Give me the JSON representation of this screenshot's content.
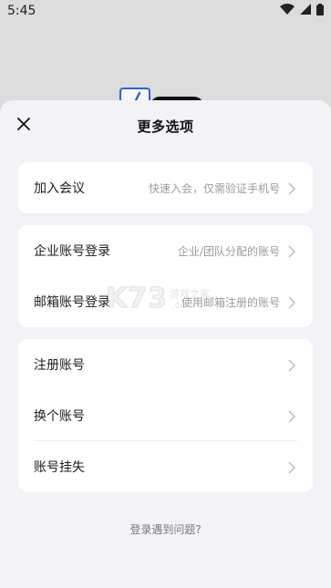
{
  "status_bar": {
    "time": "5:45"
  },
  "sheet": {
    "title": "更多选项",
    "groups": [
      {
        "items": [
          {
            "label": "加入会议",
            "desc": "快速入会，仅需验证手机号"
          }
        ]
      },
      {
        "items": [
          {
            "label": "企业账号登录",
            "desc": "企业/团队分配的账号"
          },
          {
            "label": "邮箱账号登录",
            "desc": "使用邮箱注册的账号"
          }
        ]
      },
      {
        "items": [
          {
            "label": "注册账号",
            "desc": ""
          },
          {
            "label": "换个账号",
            "desc": ""
          },
          {
            "label": "账号挂失",
            "desc": ""
          }
        ]
      }
    ],
    "help_link": "登录遇到问题?"
  },
  "watermark": {
    "main": "K73",
    "sub": "游戏之家",
    "domain": ".com"
  },
  "icons": {
    "close": "close-icon",
    "chevron": "chevron-right-icon",
    "wifi": "wifi-icon",
    "signal": "signal-icon",
    "battery": "battery-icon"
  },
  "colors": {
    "sheet_bg": "#f2f2f7",
    "card_bg": "#ffffff",
    "desc_text": "#9b9b9b",
    "backdrop": "#dcdcdc"
  }
}
